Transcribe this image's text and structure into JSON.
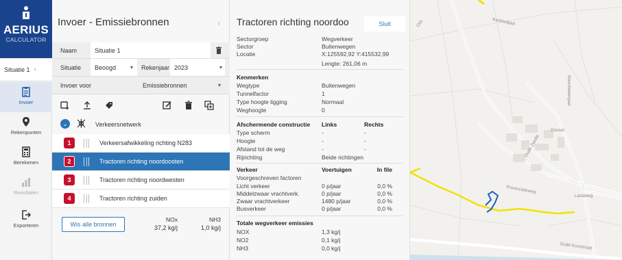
{
  "app": {
    "brand": "AERIUS",
    "subtitle": "CALCULATOR"
  },
  "nav": {
    "situation": "Situatie 1",
    "items": [
      {
        "label": "Invoer",
        "icon": "clipboard-icon"
      },
      {
        "label": "Rekenpunten",
        "icon": "map-pin-icon"
      },
      {
        "label": "Berekenen",
        "icon": "calculator-icon"
      },
      {
        "label": "Resultaten",
        "icon": "chart-icon"
      },
      {
        "label": "Exporteren",
        "icon": "export-icon"
      }
    ]
  },
  "input": {
    "title": "Invoer - Emissiebronnen",
    "name_label": "Naam",
    "name_value": "Situatie 1",
    "situation_label": "Situatie",
    "situation_value": "Beoogd",
    "year_label": "Rekenjaar",
    "year_value": "2023",
    "invoer_label": "Invoer voor",
    "invoer_value": "Emissiebronnen",
    "group_label": "Verkeersnetwerk",
    "sources": [
      {
        "num": "1",
        "label": "Verkeersafwikkeling richting N283"
      },
      {
        "num": "2",
        "label": "Tractoren richting noordoosten"
      },
      {
        "num": "3",
        "label": "Tractoren richting noordwesten"
      },
      {
        "num": "4",
        "label": "Tractoren richting zuiden"
      }
    ],
    "wis_button": "Wis alle bronnen",
    "emissions": [
      {
        "name": "NOx",
        "value": "37,2 kg/j"
      },
      {
        "name": "NH3",
        "value": "1,0 kg/j"
      }
    ]
  },
  "detail": {
    "title": "Tractoren richting noordoo",
    "close": "Sluit",
    "general": [
      {
        "k": "Sectorgroep",
        "v": "Wegverkeer"
      },
      {
        "k": "Sector",
        "v": "Buitenwegen"
      },
      {
        "k": "Locatie",
        "v": "X:125592,92 Y:415532,99"
      }
    ],
    "length": "Lengte: 261,06 m",
    "kenmerken_title": "Kenmerken",
    "kenmerken": [
      {
        "k": "Wegtype",
        "v": "Buitenwegen"
      },
      {
        "k": "Tunnelfactor",
        "v": "1"
      },
      {
        "k": "Type hoogte ligging",
        "v": "Normaal"
      },
      {
        "k": "Weghoogte",
        "v": "0"
      }
    ],
    "afscherming_title": "Afschermende constructie",
    "links": "Links",
    "rechts": "Rechts",
    "afscherming": [
      {
        "k": "Type scherm",
        "l": "-",
        "r": "-"
      },
      {
        "k": "Hoogte",
        "l": "-",
        "r": "-"
      },
      {
        "k": "Afstand tot de weg",
        "l": "-",
        "r": "-"
      }
    ],
    "rijrichting_k": "Rijrichting",
    "rijrichting_v": "Beide richtingen",
    "verkeer_title": "Verkeer",
    "voertuigen": "Voertuigen",
    "in_file": "In file",
    "voorgeschreven": "Voorgeschreven factoren",
    "verkeer": [
      {
        "k": "Licht verkeer",
        "v": "0 p/jaar",
        "f": "0,0 %"
      },
      {
        "k": "Middelzwaar vrachtverk.",
        "v": "0 p/jaar",
        "f": "0,0 %"
      },
      {
        "k": "Zwaar vrachtverkeer",
        "v": "1480 p/jaar",
        "f": "0,0 %"
      },
      {
        "k": "Busverkeer",
        "v": "0 p/jaar",
        "f": "0,0 %"
      }
    ],
    "totale_title": "Totale wegverkeer emissies",
    "totale": [
      {
        "k": "NOX",
        "v": "1,3 kg/j"
      },
      {
        "k": "NO2",
        "v": "0,1 kg/j"
      },
      {
        "k": "NH3",
        "v": "0,0 kg/j"
      }
    ]
  },
  "map": {
    "labels": [
      "Kerkhofpad",
      "Noordweterpad",
      "Dusset",
      "Oude Zwolle",
      "Provincialeweg",
      "Landweg",
      "Oude Kunstroad",
      "Oss"
    ]
  },
  "colors": {
    "brand": "#19438c",
    "selected": "#2d75b6",
    "badge": "#c8102e",
    "route": "#f2e200"
  }
}
